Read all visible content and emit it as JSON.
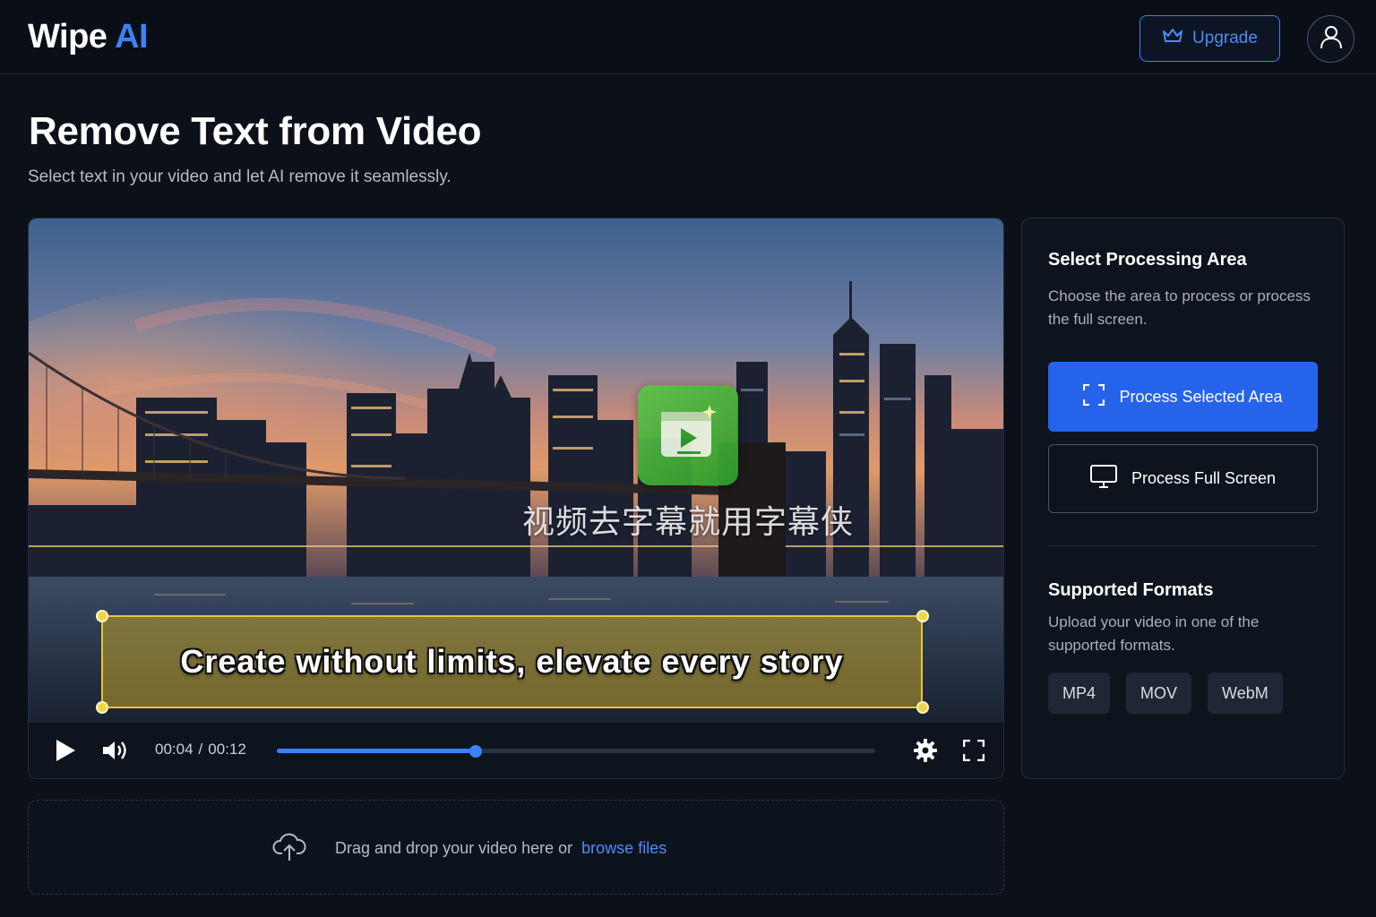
{
  "app": {
    "logo_main": "Wipe",
    "logo_accent": "AI"
  },
  "header": {
    "upgrade_label": "Upgrade"
  },
  "page": {
    "title": "Remove Text from Video",
    "subtitle": "Select text in your video and let AI remove it seamlessly."
  },
  "video": {
    "watermark_text": "视频去字幕就用字幕侠",
    "caption_text": "Create without limits, elevate every story",
    "current_time": "00:04",
    "duration": "00:12",
    "progress_fraction": 0.333
  },
  "dropzone": {
    "text": "Drag and drop your video here or",
    "link": "browse files"
  },
  "panel": {
    "area_title": "Select Processing Area",
    "area_desc": "Choose the area to process or process the full screen.",
    "process_selected_label": "Process Selected Area",
    "process_full_label": "Process Full Screen",
    "formats_title": "Supported Formats",
    "formats_desc": "Upload your video in one of the supported formats.",
    "formats": [
      "MP4",
      "MOV",
      "WebM"
    ]
  },
  "colors": {
    "accent": "#3b82f6",
    "primary_button": "#2563eb",
    "selection_border": "#e8c530",
    "background": "#0b1019"
  }
}
